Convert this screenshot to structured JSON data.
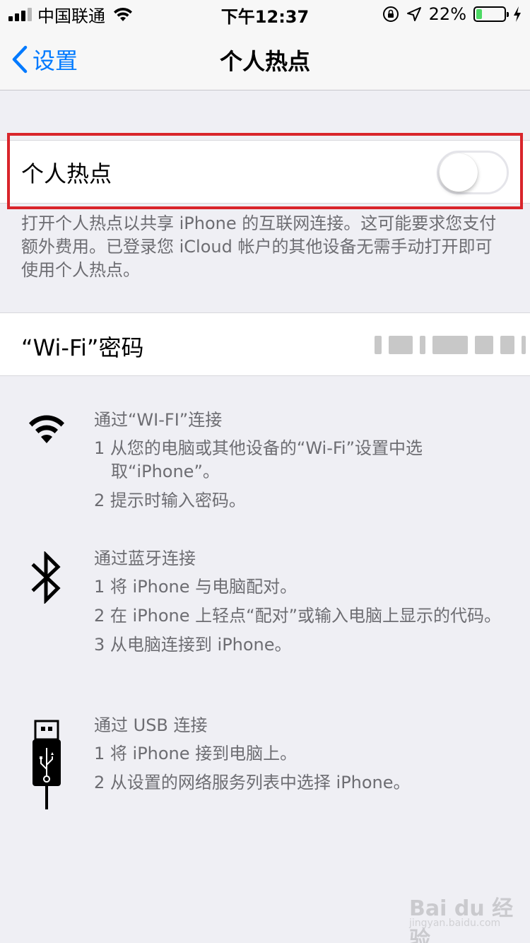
{
  "status_bar": {
    "carrier": "中国联通",
    "time": "下午12:37",
    "battery_percent": "22%",
    "battery_level": 0.22,
    "battery_color": "#4cd964",
    "icons": [
      "signal-icon",
      "wifi-icon",
      "orientation-lock-icon",
      "location-icon",
      "battery-icon",
      "charging-icon"
    ]
  },
  "nav": {
    "back_label": "设置",
    "title": "个人热点",
    "accent_color": "#007aff"
  },
  "hotspot": {
    "label": "个人热点",
    "enabled": false,
    "footer": "打开个人热点以共享 iPhone 的互联网连接。这可能要求您支付额外费用。已登录您 iCloud 帐户的其他设备无需手动打开即可使用个人热点。"
  },
  "wifi_password": {
    "label": "“Wi-Fi”密码"
  },
  "instructions": [
    {
      "icon": "wifi-icon",
      "heading": "通过“WI-FI”连接",
      "steps": [
        "1 从您的电脑或其他设备的“Wi-Fi”设置中选取“iPhone”。",
        "2 提示时输入密码。"
      ]
    },
    {
      "icon": "bluetooth-icon",
      "heading": "通过蓝牙连接",
      "steps": [
        "1 将 iPhone 与电脑配对。",
        "2 在 iPhone 上轻点“配对”或输入电脑上显示的代码。",
        "3 从电脑连接到 iPhone。"
      ]
    },
    {
      "icon": "usb-icon",
      "heading": "通过 USB 连接",
      "steps": [
        "1 将 iPhone 接到电脑上。",
        "2 从设置的网络服务列表中选择 iPhone。"
      ]
    }
  ],
  "watermark": {
    "main": "Bai du 经验",
    "sub": "jingyan.baidu.com"
  }
}
